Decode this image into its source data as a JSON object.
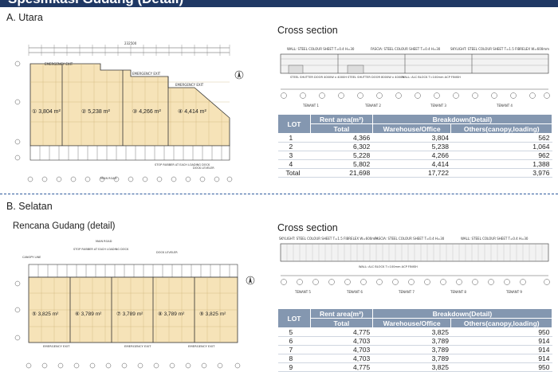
{
  "header": {
    "title": "Spesifikasi Gudang (Detail)"
  },
  "north": {
    "title": "A. Utara",
    "cross_section_title": "Cross section",
    "plan": {
      "units": [
        {
          "label": "① 3,804 m²"
        },
        {
          "label": "② 5,238 m²"
        },
        {
          "label": "③ 4,266 m²"
        },
        {
          "label": "④ 4,414 m²"
        }
      ],
      "emergency_exit": "EMERGENCY EXIT",
      "main_road": "MAIN ROAD",
      "stop_rubber": "STOP RUBBER AT EACH LOADING DOCK",
      "dock_leveler": "DOCK LEVELER",
      "overall_dim": "232500"
    },
    "xsec": {
      "notes": [
        "WALL: STEEL COLOUR SHEET T=0.4 H=30",
        "FASCIA: STEEL COLOUR SHEET T=0.4 H=30",
        "SKYLIGHT: STEEL COLOUR SHEET T=1.5 FIBRELEX W=600mm"
      ],
      "shutter1": "STEEL SHUTTER DOOR 4000W x 4000H",
      "shutter2": "STEEL SHUTTER DOOR 8000W x 4000H",
      "alc": "WALL: ALC BLOCK T=100mm ACP FINISH",
      "tenants": [
        "TENANT 1",
        "TENANT 2",
        "TENANT 3",
        "TENANT 4"
      ]
    },
    "table": {
      "header": {
        "lot": "LOT",
        "rent_area": "Rent area(m²)",
        "breakdown": "Breakdown(Detail)",
        "total": "Total",
        "warehouse": "Warehouse/Office",
        "others": "Others(canopy,loading)"
      },
      "rows": [
        {
          "lot": "1",
          "total": "4,366",
          "warehouse": "3,804",
          "others": "562"
        },
        {
          "lot": "2",
          "total": "6,302",
          "warehouse": "5,238",
          "others": "1,064"
        },
        {
          "lot": "3",
          "total": "5,228",
          "warehouse": "4,266",
          "others": "962"
        },
        {
          "lot": "4",
          "total": "5,802",
          "warehouse": "4,414",
          "others": "1,388"
        },
        {
          "lot": "Total",
          "total": "21,698",
          "warehouse": "17,722",
          "others": "3,976"
        }
      ]
    }
  },
  "south": {
    "title": "B. Selatan",
    "plan_title": "Rencana Gudang (detail)",
    "cross_section_title": "Cross section",
    "plan": {
      "units": [
        {
          "label": "⑤ 3,825 m²"
        },
        {
          "label": "⑥ 3,789 m²"
        },
        {
          "label": "⑦ 3,789 m²"
        },
        {
          "label": "⑧ 3,789 m²"
        },
        {
          "label": "⑨ 3,825 m²"
        }
      ],
      "emergency_exit": "EMERGENCY EXIT",
      "main_road": "MAIN ROAD",
      "stop_rubber": "STOP RUBBER AT EACH LOADING DOCK",
      "dock_leveler": "DOCK LEVELER",
      "canopy_line": "CANOPY LINE"
    },
    "xsec": {
      "notes": [
        "SKYLIGHT: STEEL COLOUR SHEET T=1.5 FIBRELEX W=600mm",
        "FASCIA: STEEL COLOUR SHEET T=0.4 H=30",
        "WALL: STEEL COLOUR SHEET T=0.4 H=30"
      ],
      "alc": "WALL: ALC BLOCK T=100mm ACP FINISH",
      "tenants": [
        "TENANT 5",
        "TENANT 6",
        "TENANT 7",
        "TENANT 8",
        "TENANT 9"
      ]
    },
    "table": {
      "header": {
        "lot": "LOT",
        "rent_area": "Rent area(m²)",
        "breakdown": "Breakdown(Detail)",
        "total": "Total",
        "warehouse": "Warehouse/Office",
        "others": "Others(canopy,loading)"
      },
      "rows": [
        {
          "lot": "5",
          "total": "4,775",
          "warehouse": "3,825",
          "others": "950"
        },
        {
          "lot": "6",
          "total": "4,703",
          "warehouse": "3,789",
          "others": "914"
        },
        {
          "lot": "7",
          "total": "4,703",
          "warehouse": "3,789",
          "others": "914"
        },
        {
          "lot": "8",
          "total": "4,703",
          "warehouse": "3,789",
          "others": "914"
        },
        {
          "lot": "9",
          "total": "4,775",
          "warehouse": "3,825",
          "others": "950"
        }
      ]
    }
  }
}
